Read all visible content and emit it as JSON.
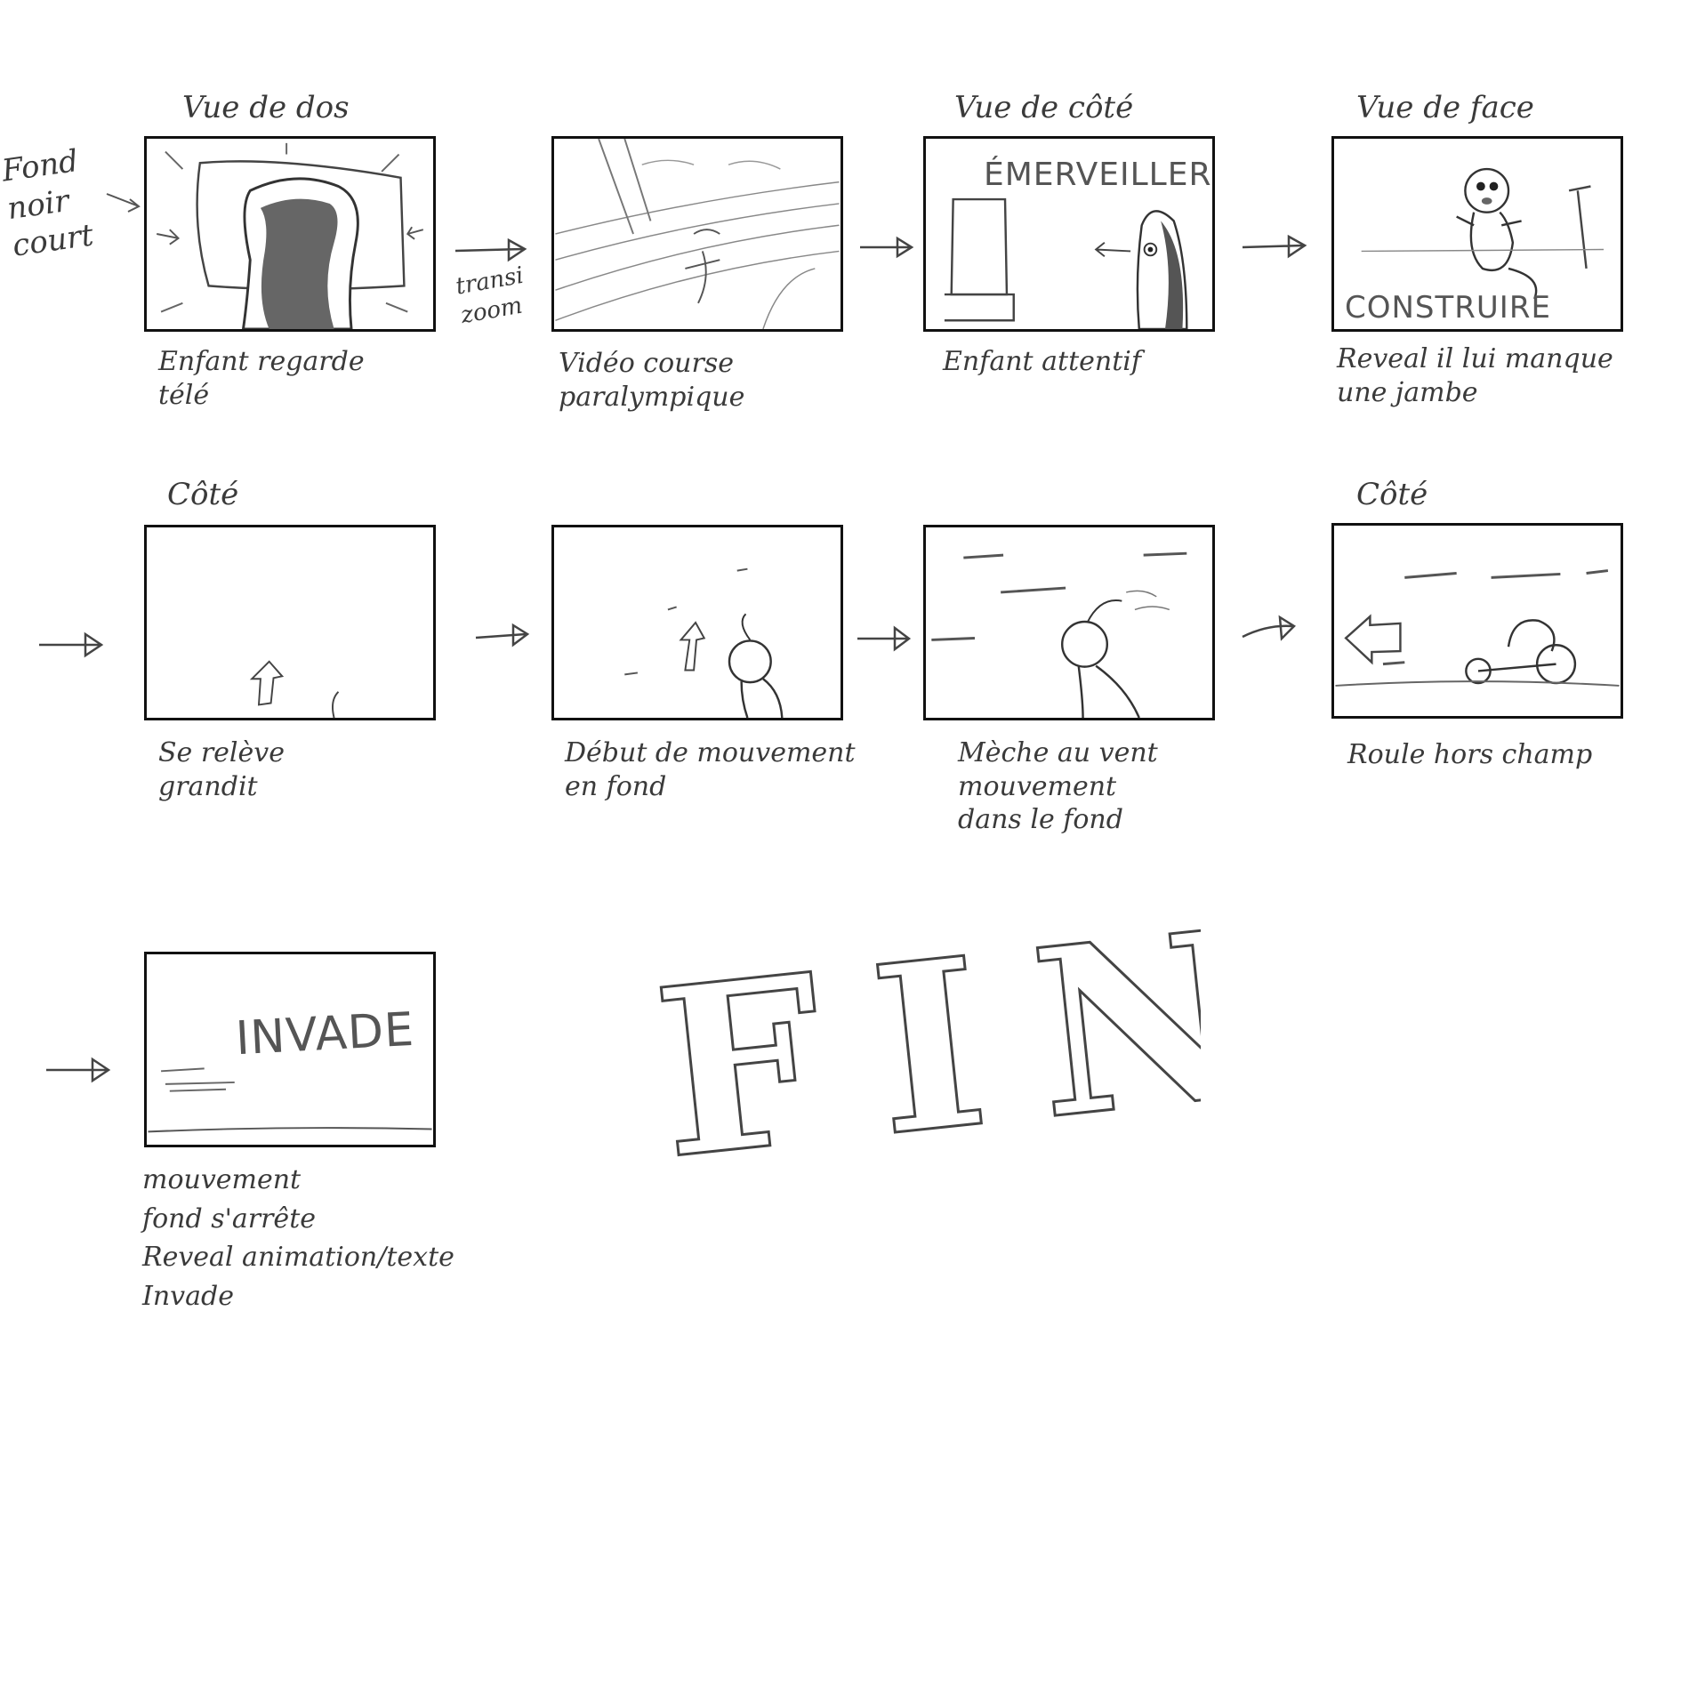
{
  "side_note": "Fond\nnoir\ncourt",
  "panels": [
    {
      "heading": "Vue de dos",
      "caption": "Enfant regarde\ntélé",
      "inner_text": ""
    },
    {
      "heading": "",
      "caption": "Vidéo course\nparalympique",
      "inner_text": ""
    },
    {
      "heading": "Vue de côté",
      "caption": "Enfant attentif",
      "inner_text": "ÉMERVEILLER"
    },
    {
      "heading": "Vue de face",
      "caption": "Reveal il lui manque\nune jambe",
      "inner_text": "CONSTRUIRE"
    },
    {
      "heading": "Côté",
      "caption": "Se relève\ngrandit",
      "inner_text": ""
    },
    {
      "heading": "",
      "caption": "Début de mouvement\nen fond",
      "inner_text": ""
    },
    {
      "heading": "",
      "caption": "Mèche au vent\nmouvement\ndans le fond",
      "inner_text": ""
    },
    {
      "heading": "Côté",
      "caption": "Roule hors champ",
      "inner_text": ""
    },
    {
      "heading": "",
      "caption": "mouvement\nfond s'arrête\nReveal animation/texte\nInvade",
      "inner_text": "INVADE"
    }
  ],
  "transition_note": "transi\nzoom",
  "ending": "FIN"
}
